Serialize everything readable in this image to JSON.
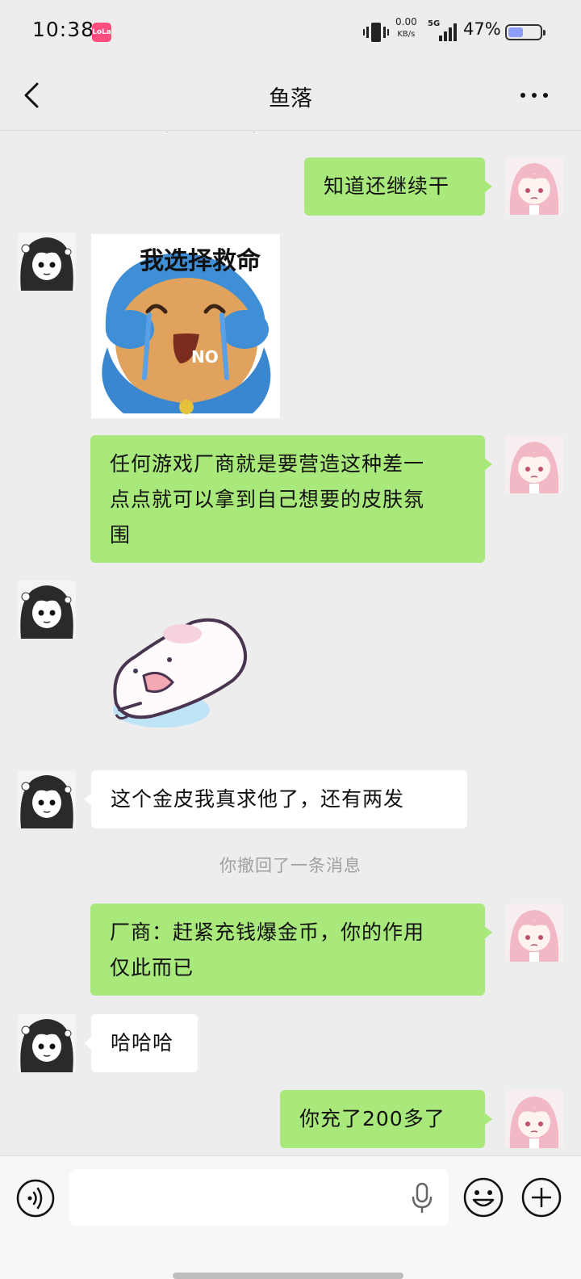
{
  "status_bar": {
    "time": "10:38",
    "app_badge": "LoLa",
    "net_speed_value": "0.00",
    "net_speed_unit": "KB/s",
    "network_type": "5G",
    "battery_percent": "47%",
    "battery_level": 0.47
  },
  "header": {
    "title": "鱼落",
    "back_icon": "chevron-left-icon",
    "more_icon": "ellipsis-icon"
  },
  "messages": [
    {
      "sender": "me",
      "type": "text",
      "text": "知道还继续干"
    },
    {
      "sender": "them",
      "type": "sticker",
      "caption": "我选择救命",
      "label": "NO"
    },
    {
      "sender": "me",
      "type": "text",
      "lines": [
        "任何游戏厂商就是要营造这种差一",
        "点点就可以拿到自己想要的皮肤氛",
        "围"
      ]
    },
    {
      "sender": "them",
      "type": "sticker",
      "description": "crying-mochi-sticker"
    },
    {
      "sender": "them",
      "type": "text",
      "text": "这个金皮我真求他了，还有两发"
    },
    {
      "sender": "system",
      "type": "notice",
      "text": "你撤回了一条消息"
    },
    {
      "sender": "me",
      "type": "text",
      "lines": [
        "厂商：赶紧充钱爆金币，你的作用",
        "仅此而已"
      ]
    },
    {
      "sender": "them",
      "type": "text",
      "text": "哈哈哈"
    },
    {
      "sender": "me",
      "type": "text",
      "text": "你充了200多了"
    }
  ],
  "input_bar": {
    "placeholder": "",
    "voice_icon": "voice-icon",
    "mic_icon": "microphone-icon",
    "emoji_icon": "emoji-icon",
    "plus_icon": "plus-icon"
  },
  "colors": {
    "background": "#ededed",
    "my_bubble": "#a9e87a",
    "their_bubble": "#ffffff",
    "system_text": "#a0a0a0"
  }
}
